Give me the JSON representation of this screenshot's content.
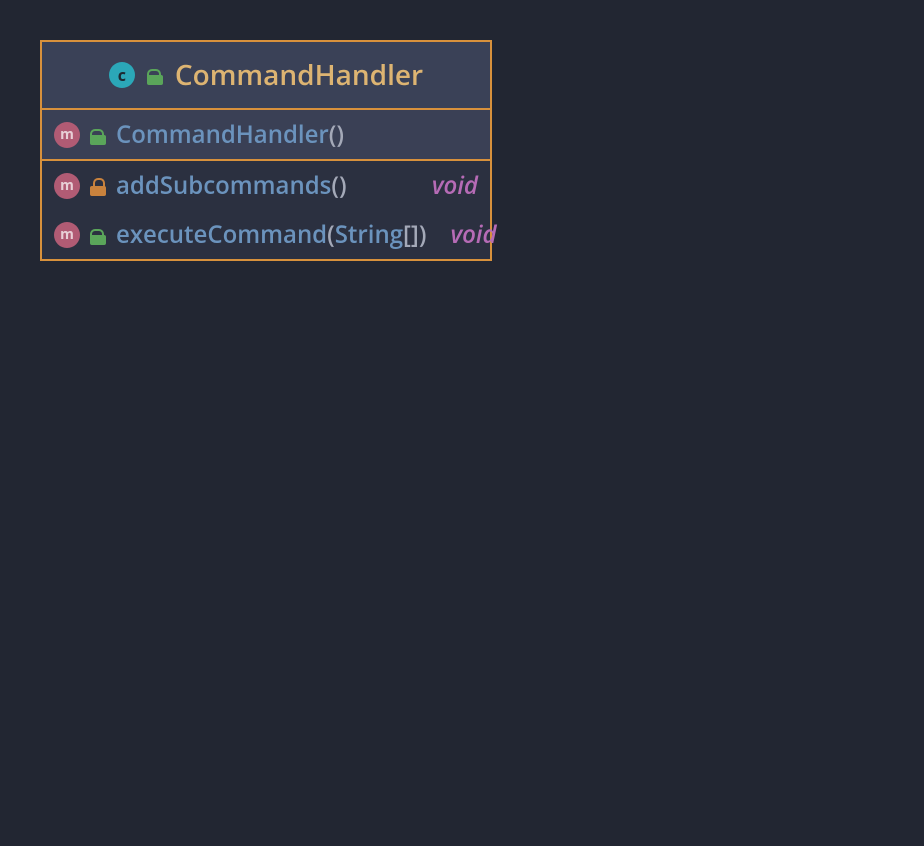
{
  "class": {
    "kind_glyph": "c",
    "visibility": "public",
    "name": "CommandHandler"
  },
  "members": [
    {
      "kind_glyph": "m",
      "visibility": "public",
      "name": "CommandHandler",
      "params_open": "(",
      "params_close": ")",
      "param_type": "",
      "param_brackets": "",
      "return_type": "",
      "selected": true
    },
    {
      "kind_glyph": "m",
      "visibility": "private",
      "name": "addSubcommands",
      "params_open": "(",
      "params_close": ")",
      "param_type": "",
      "param_brackets": "",
      "return_type": "void",
      "selected": false
    },
    {
      "kind_glyph": "m",
      "visibility": "public",
      "name": "executeCommand",
      "params_open": "(",
      "params_close": ")",
      "param_type": "String",
      "param_brackets": "[]",
      "return_type": "void",
      "selected": false
    }
  ]
}
